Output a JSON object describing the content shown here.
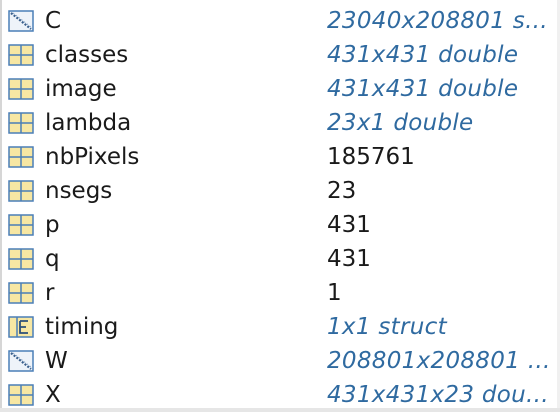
{
  "workspace": {
    "variables": [
      {
        "name": "C",
        "value": "23040x208801 s...",
        "icon": "sparse-matrix-icon",
        "value_style": "info"
      },
      {
        "name": "classes",
        "value": "431x431 double",
        "icon": "grid-icon",
        "value_style": "info"
      },
      {
        "name": "image",
        "value": "431x431 double",
        "icon": "grid-icon",
        "value_style": "info"
      },
      {
        "name": "lambda",
        "value": "23x1 double",
        "icon": "grid-icon",
        "value_style": "info"
      },
      {
        "name": "nbPixels",
        "value": "185761",
        "icon": "grid-icon",
        "value_style": "plain"
      },
      {
        "name": "nsegs",
        "value": "23",
        "icon": "grid-icon",
        "value_style": "plain"
      },
      {
        "name": "p",
        "value": "431",
        "icon": "grid-icon",
        "value_style": "plain"
      },
      {
        "name": "q",
        "value": "431",
        "icon": "grid-icon",
        "value_style": "plain"
      },
      {
        "name": "r",
        "value": "1",
        "icon": "grid-icon",
        "value_style": "plain"
      },
      {
        "name": "timing",
        "value": "1x1 struct",
        "icon": "struct-icon",
        "value_style": "info"
      },
      {
        "name": "W",
        "value": "208801x208801 ...",
        "icon": "sparse-matrix-icon",
        "value_style": "info"
      },
      {
        "name": "X",
        "value": "431x431x23 dou...",
        "icon": "grid-icon",
        "value_style": "info"
      }
    ]
  },
  "colors": {
    "info_text": "#2f6aa0",
    "plain_text": "#1a1a1a",
    "icon_fill": "#f7e7a3",
    "icon_stroke": "#4a7fb7"
  }
}
